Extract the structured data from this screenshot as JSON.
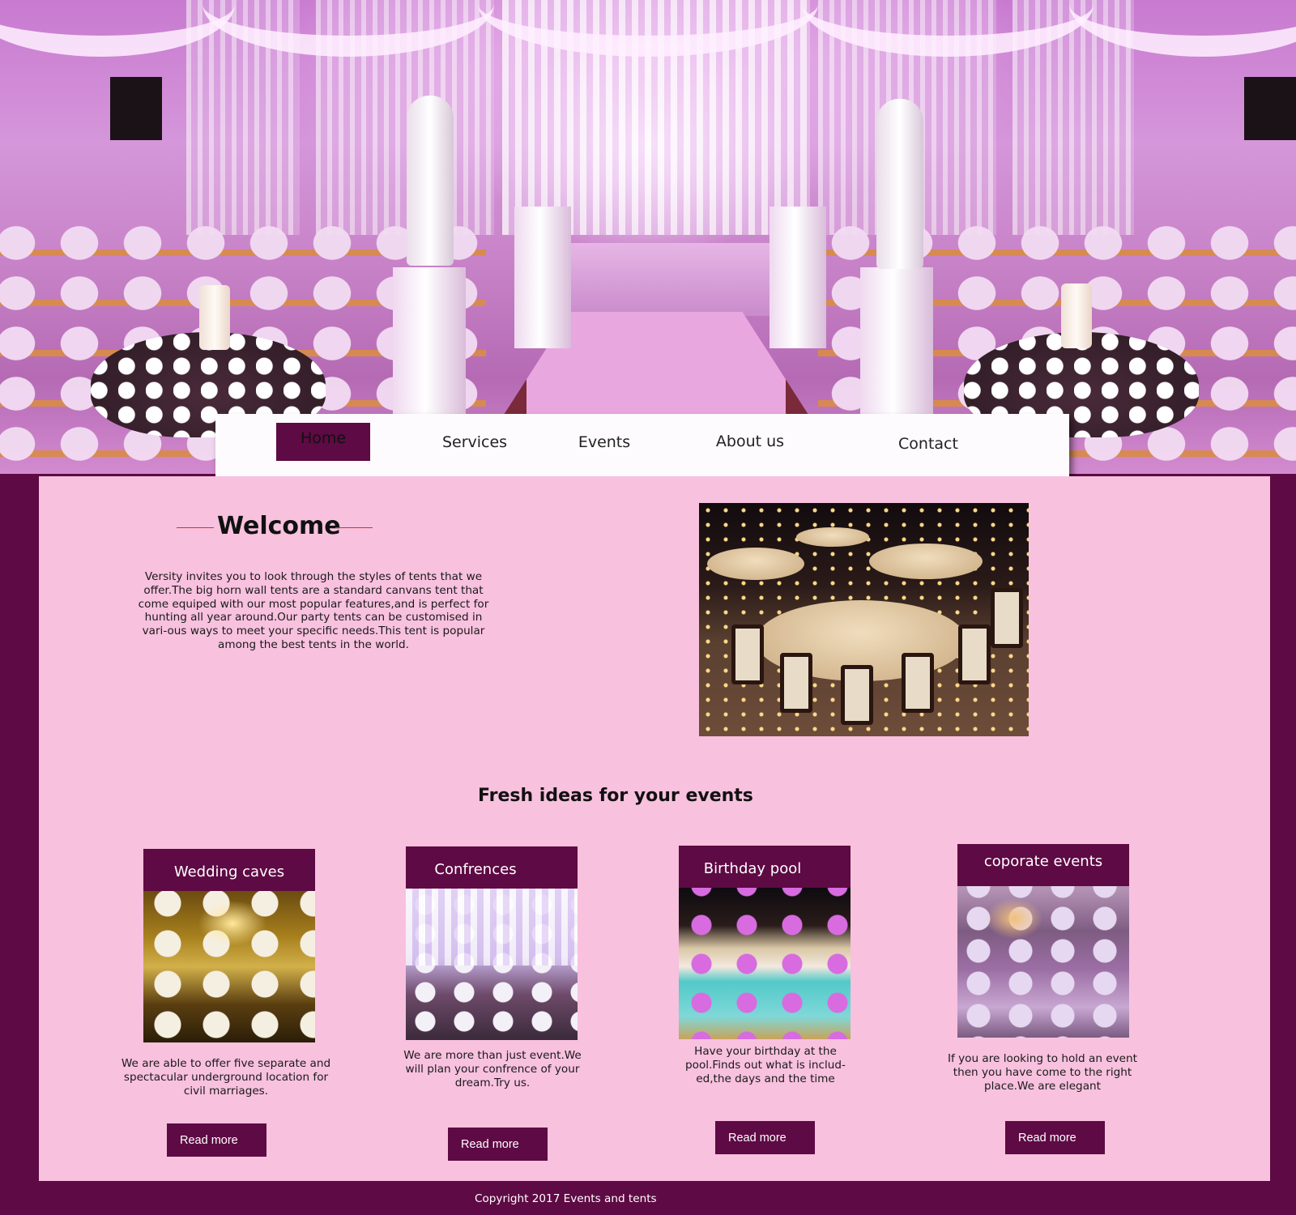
{
  "nav": {
    "items": [
      {
        "label": "Home",
        "active": true
      },
      {
        "label": "Services"
      },
      {
        "label": "Events"
      },
      {
        "label": "About us"
      },
      {
        "label": "Contact"
      }
    ]
  },
  "welcome": {
    "title": "Welcome",
    "text": "Versity invites you to look through the styles of tents that we offer.The big horn wall tents are a standard canvans tent that come equiped with our most popular features,and is perfect for hunting all year around.Our party tents can be customised in vari-ous ways to meet your specific needs.This tent is popular among the best tents in the world."
  },
  "fresh_ideas": {
    "title": "Fresh ideas for your events",
    "cards": [
      {
        "heading": "Wedding caves",
        "text": "We are able to offer five separate and spectacular underground location for civil marriages.",
        "button": "Read more"
      },
      {
        "heading": "Confrences",
        "text": "We are more than just event.We will plan your confrence of your dream.Try us.",
        "button": "Read more"
      },
      {
        "heading": "Birthday pool",
        "text": "Have your birthday at the pool.Finds out  what is includ-ed,the days and the time",
        "button": "Read more"
      },
      {
        "heading": "coporate events",
        "text": "If you are looking to hold an event then you have come to the right place.We are elegant",
        "button": "Read more"
      }
    ]
  },
  "footer": {
    "copyright": "Copyright 2017 Events and tents"
  },
  "colors": {
    "brand": "#5e0a44",
    "panel": "#f8c1de",
    "accent_line": "#c0392b"
  }
}
